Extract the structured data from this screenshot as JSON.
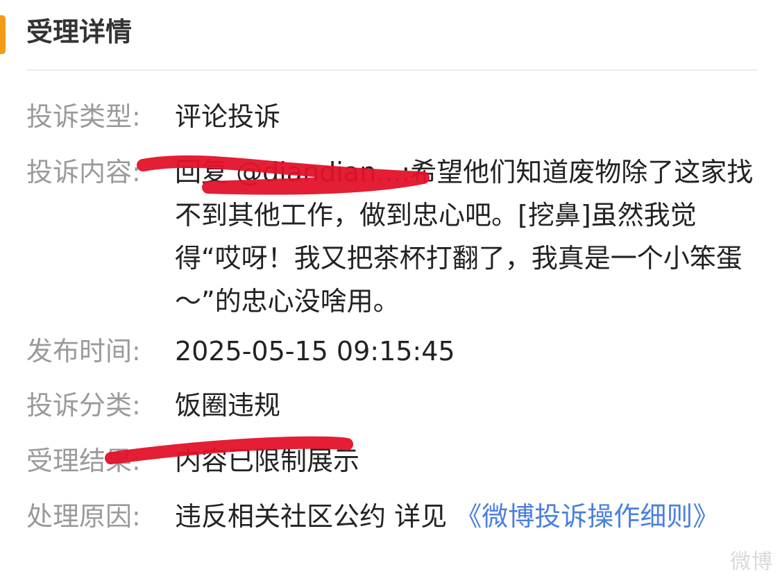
{
  "section": {
    "title": "受理详情",
    "accent_color": "#f39b16"
  },
  "details": {
    "type": {
      "label": "投诉类型:",
      "value": "评论投诉"
    },
    "content": {
      "label": "投诉内容:",
      "value": "回复 @diandian...:希望他们知道废物除了这家找不到其他工作，做到忠心吧。[挖鼻]虽然我觉得“哎呀！我又把茶杯打翻了，我真是一个小笨蛋～”的忠心没啥用。"
    },
    "publish_time": {
      "label": "发布时间:",
      "value": "2025-05-15 09:15:45"
    },
    "category": {
      "label": "投诉分类:",
      "value": "饭圈违规"
    },
    "result": {
      "label": "受理结果:",
      "value": "内容已限制展示"
    },
    "reason": {
      "label": "处理原因:",
      "value": "违反相关社区公约 详见",
      "link": "《微博投诉操作细则》"
    }
  },
  "watermark": "微博"
}
